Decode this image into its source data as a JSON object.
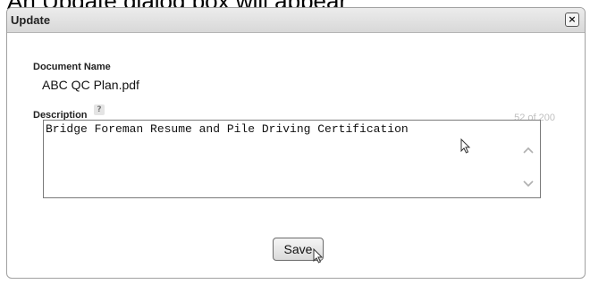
{
  "caption": "An Update dialog box will appear",
  "dialog": {
    "title": "Update",
    "close_symbol": "×",
    "document_name_label": "Document Name",
    "document_name_value": "ABC QC Plan.pdf",
    "description_label": "Description",
    "help_symbol": "?",
    "char_counter": "52 of 200",
    "description_value": "Bridge Foreman Resume and Pile Driving Certification",
    "save_label": "Save"
  },
  "icons": {
    "close": "close-icon",
    "help": "help-icon",
    "scroll_up": "chevron-up-icon",
    "scroll_down": "chevron-down-icon",
    "cursor": "mouse-pointer-icon"
  },
  "colors": {
    "titlebar": "#dcdcdc",
    "border": "#a0a0a0",
    "counter_text": "#c0c0c0"
  }
}
